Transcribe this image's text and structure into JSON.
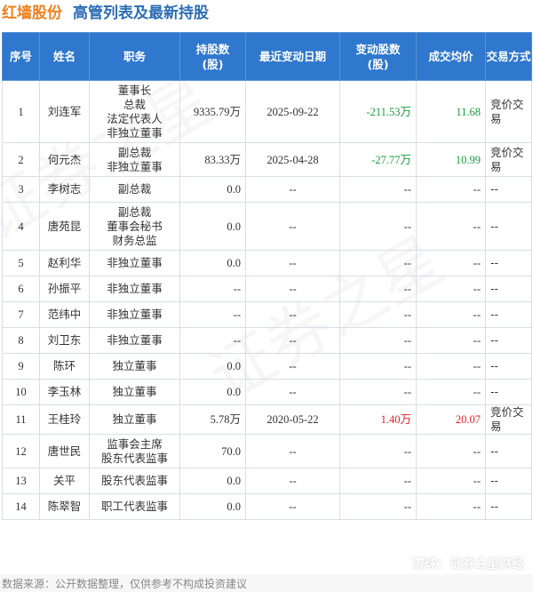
{
  "header": {
    "company": "红墙股份",
    "title": "高管列表及最新持股"
  },
  "table": {
    "columns": [
      "序号",
      "姓名",
      "职务",
      "持股数\n(股)",
      "最近变动日期",
      "变动股数\n(股)",
      "成交均价",
      "交易方式"
    ],
    "rows": [
      {
        "no": "1",
        "name": "刘连军",
        "position": [
          "董事长",
          "总裁",
          "法定代表人",
          "非独立董事"
        ],
        "shares": "9335.79万",
        "date": "2025-09-22",
        "change": "-211.53万",
        "change_dir": "neg",
        "price": "11.68",
        "price_dir": "neg",
        "method": "竞价交易"
      },
      {
        "no": "2",
        "name": "何元杰",
        "position": [
          "副总裁",
          "非独立董事"
        ],
        "shares": "83.33万",
        "date": "2025-04-28",
        "change": "-27.77万",
        "change_dir": "neg",
        "price": "10.99",
        "price_dir": "neg",
        "method": "竞价交易"
      },
      {
        "no": "3",
        "name": "李树志",
        "position": [
          "副总裁"
        ],
        "shares": "0.0",
        "date": "--",
        "change": "--",
        "change_dir": "",
        "price": "--",
        "price_dir": "",
        "method": "--"
      },
      {
        "no": "4",
        "name": "唐苑昆",
        "position": [
          "副总裁",
          "董事会秘书",
          "财务总监"
        ],
        "shares": "0.0",
        "date": "--",
        "change": "--",
        "change_dir": "",
        "price": "--",
        "price_dir": "",
        "method": "--"
      },
      {
        "no": "5",
        "name": "赵利华",
        "position": [
          "非独立董事"
        ],
        "shares": "0.0",
        "date": "--",
        "change": "--",
        "change_dir": "",
        "price": "--",
        "price_dir": "",
        "method": "--"
      },
      {
        "no": "6",
        "name": "孙振平",
        "position": [
          "非独立董事"
        ],
        "shares": "--",
        "date": "--",
        "change": "--",
        "change_dir": "",
        "price": "--",
        "price_dir": "",
        "method": "--"
      },
      {
        "no": "7",
        "name": "范纬中",
        "position": [
          "非独立董事"
        ],
        "shares": "--",
        "date": "--",
        "change": "--",
        "change_dir": "",
        "price": "--",
        "price_dir": "",
        "method": "--"
      },
      {
        "no": "8",
        "name": "刘卫东",
        "position": [
          "非独立董事"
        ],
        "shares": "--",
        "date": "--",
        "change": "--",
        "change_dir": "",
        "price": "--",
        "price_dir": "",
        "method": "--"
      },
      {
        "no": "9",
        "name": "陈环",
        "position": [
          "独立董事"
        ],
        "shares": "0.0",
        "date": "--",
        "change": "--",
        "change_dir": "",
        "price": "--",
        "price_dir": "",
        "method": "--"
      },
      {
        "no": "10",
        "name": "李玉林",
        "position": [
          "独立董事"
        ],
        "shares": "0.0",
        "date": "--",
        "change": "--",
        "change_dir": "",
        "price": "--",
        "price_dir": "",
        "method": "--"
      },
      {
        "no": "11",
        "name": "王桂玲",
        "position": [
          "独立董事"
        ],
        "shares": "5.78万",
        "date": "2020-05-22",
        "change": "1.40万",
        "change_dir": "pos",
        "price": "20.07",
        "price_dir": "pos",
        "method": "竞价交易"
      },
      {
        "no": "12",
        "name": "唐世民",
        "position": [
          "监事会主席",
          "股东代表监事"
        ],
        "shares": "70.0",
        "date": "--",
        "change": "--",
        "change_dir": "",
        "price": "--",
        "price_dir": "",
        "method": "--"
      },
      {
        "no": "13",
        "name": "关平",
        "position": [
          "股东代表监事"
        ],
        "shares": "0.0",
        "date": "--",
        "change": "--",
        "change_dir": "",
        "price": "--",
        "price_dir": "",
        "method": "--"
      },
      {
        "no": "14",
        "name": "陈翠智",
        "position": [
          "职工代表监事"
        ],
        "shares": "0.0",
        "date": "--",
        "change": "--",
        "change_dir": "",
        "price": "--",
        "price_dir": "",
        "method": "--"
      }
    ]
  },
  "footer": {
    "source": "数据来源：公开数据整理，仅供参考不构成投资建议"
  },
  "brand": {
    "text": "雪球：证券之星财经"
  },
  "watermark": "证券之星",
  "colors": {
    "company": "#f07f1b",
    "title": "#2b6db5",
    "header_bg": "#2f78cd",
    "negative": "#1a9c3e",
    "positive": "#e4201f"
  }
}
